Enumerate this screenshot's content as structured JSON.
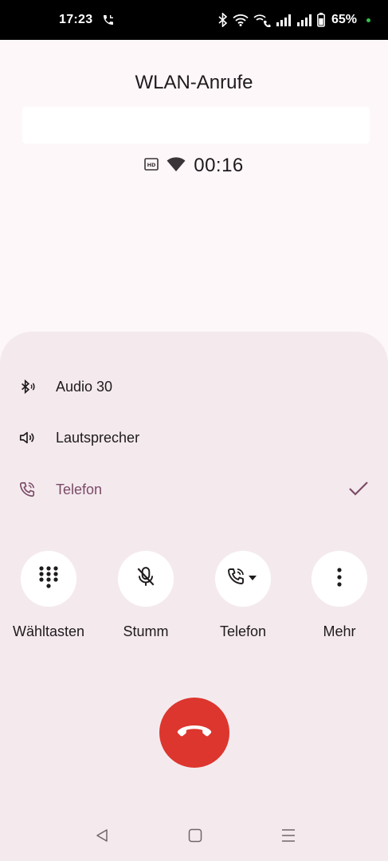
{
  "status_bar": {
    "time": "17:23",
    "battery_percent": "65%",
    "icons": [
      "call-active-icon",
      "bluetooth-icon",
      "wifi-icon",
      "wifi-calling-icon",
      "signal-icon",
      "signal-icon",
      "battery-icon",
      "privacy-dot"
    ]
  },
  "call": {
    "title": "WLAN-Anrufe",
    "caller_name": "",
    "timer": "00:16",
    "icons": [
      "hd-icon",
      "wifi-icon"
    ]
  },
  "audio_options": [
    {
      "label": "Audio 30",
      "icon": "bluetooth-audio-icon",
      "selected": false
    },
    {
      "label": "Lautsprecher",
      "icon": "speaker-icon",
      "selected": false
    },
    {
      "label": "Telefon",
      "icon": "phone-icon",
      "selected": true
    }
  ],
  "controls": [
    {
      "label": "Wähltasten",
      "icon": "dialpad-icon"
    },
    {
      "label": "Stumm",
      "icon": "mic-off-icon"
    },
    {
      "label": "Telefon",
      "icon": "phone-audio-route-icon"
    },
    {
      "label": "Mehr",
      "icon": "more-vert-icon"
    }
  ],
  "end_call": {
    "icon": "call-end-icon"
  },
  "nav": {
    "icons": [
      "back-icon",
      "home-icon",
      "recents-icon"
    ]
  },
  "colors": {
    "background": "#fdf7fa",
    "sheet": "#f4eaee",
    "accent": "#7b4a66",
    "end_call": "#dc362e"
  }
}
